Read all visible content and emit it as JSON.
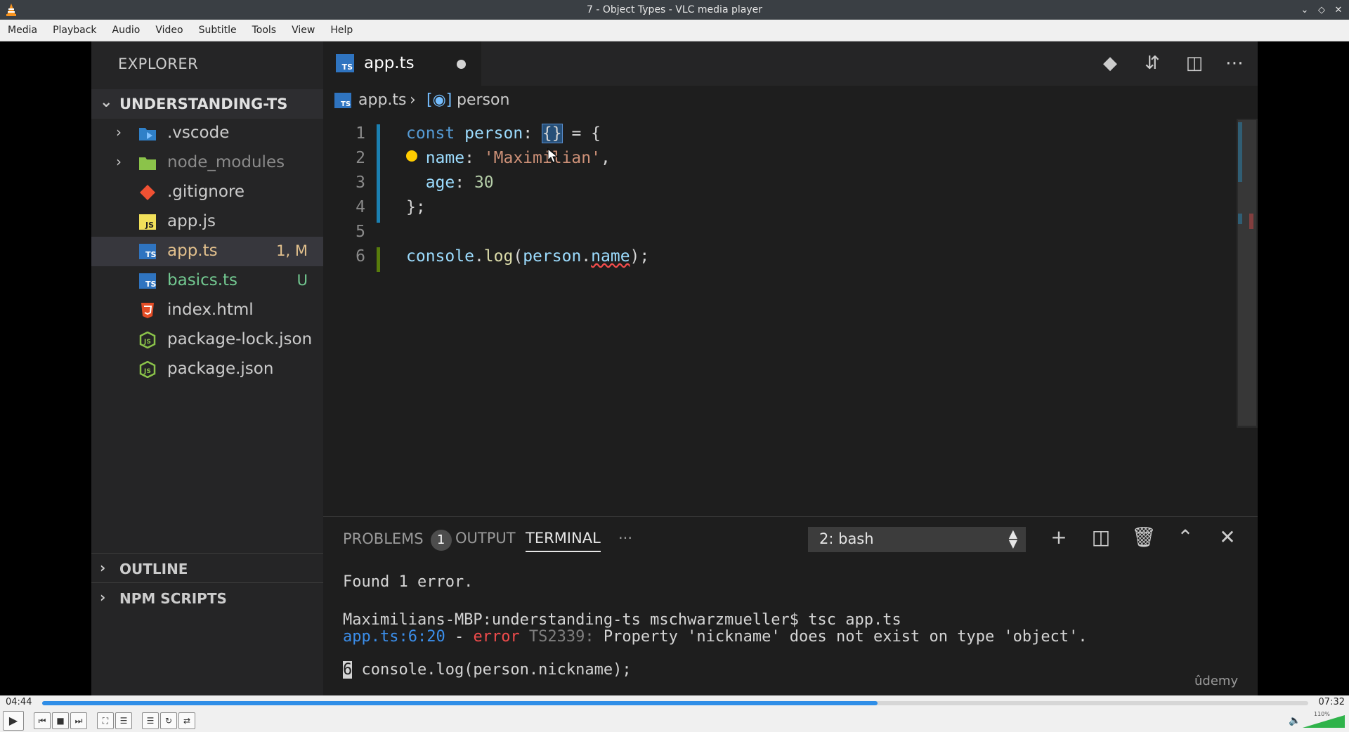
{
  "window": {
    "title": "7 - Object Types - VLC media player"
  },
  "menu": [
    "Media",
    "Playback",
    "Audio",
    "Video",
    "Subtitle",
    "Tools",
    "View",
    "Help"
  ],
  "explorer": {
    "header": "EXPLORER",
    "project": "UNDERSTANDING-TS",
    "files": [
      {
        "name": ".vscode",
        "badge": ""
      },
      {
        "name": "node_modules",
        "badge": ""
      },
      {
        "name": ".gitignore",
        "badge": ""
      },
      {
        "name": "app.js",
        "badge": ""
      },
      {
        "name": "app.ts",
        "badge": "1, M"
      },
      {
        "name": "basics.ts",
        "badge": "U"
      },
      {
        "name": "index.html",
        "badge": ""
      },
      {
        "name": "package-lock.json",
        "badge": ""
      },
      {
        "name": "package.json",
        "badge": ""
      }
    ],
    "outline": "OUTLINE",
    "npm_scripts": "NPM SCRIPTS"
  },
  "editor": {
    "tab": "app.ts",
    "breadcrumb": {
      "file": "app.ts",
      "symbol": "person"
    },
    "line_numbers": [
      "1",
      "2",
      "3",
      "4",
      "5",
      "6"
    ],
    "code": {
      "l1_kw": "const",
      "l1_var": "person",
      "l1_type": "{}",
      "l1_rest": " = {",
      "l2_key": "name",
      "l2_str": "'Maximilian'",
      "l3_key": "age",
      "l3_num": "30",
      "l4": "};",
      "l6_obj": "console",
      "l6_fn": "log",
      "l6_arg": "person",
      "l6_prop": "name"
    }
  },
  "panel": {
    "tabs": {
      "problems": "PROBLEMS",
      "problems_count": "1",
      "output": "OUTPUT",
      "terminal": "TERMINAL",
      "more": "···"
    },
    "shell": "2: bash",
    "terminal": {
      "l1": "Found 1 error.",
      "l2": "Maximilians-MBP:understanding-ts mschwarzmueller$ tsc app.ts",
      "l3_path": "app.ts:6:20",
      "l3_sep": " - ",
      "l3_err": "error",
      "l3_code": " TS2339:",
      "l3_msg": " Property 'nickname' does not exist on type 'object'.",
      "l4_num": "6",
      "l4_code": " console.log(person.nickname);"
    }
  },
  "watermark": "ûdemy",
  "player": {
    "current_time": "04:44",
    "total_time": "07:32",
    "progress": 0.66,
    "volume_label": "110%"
  }
}
